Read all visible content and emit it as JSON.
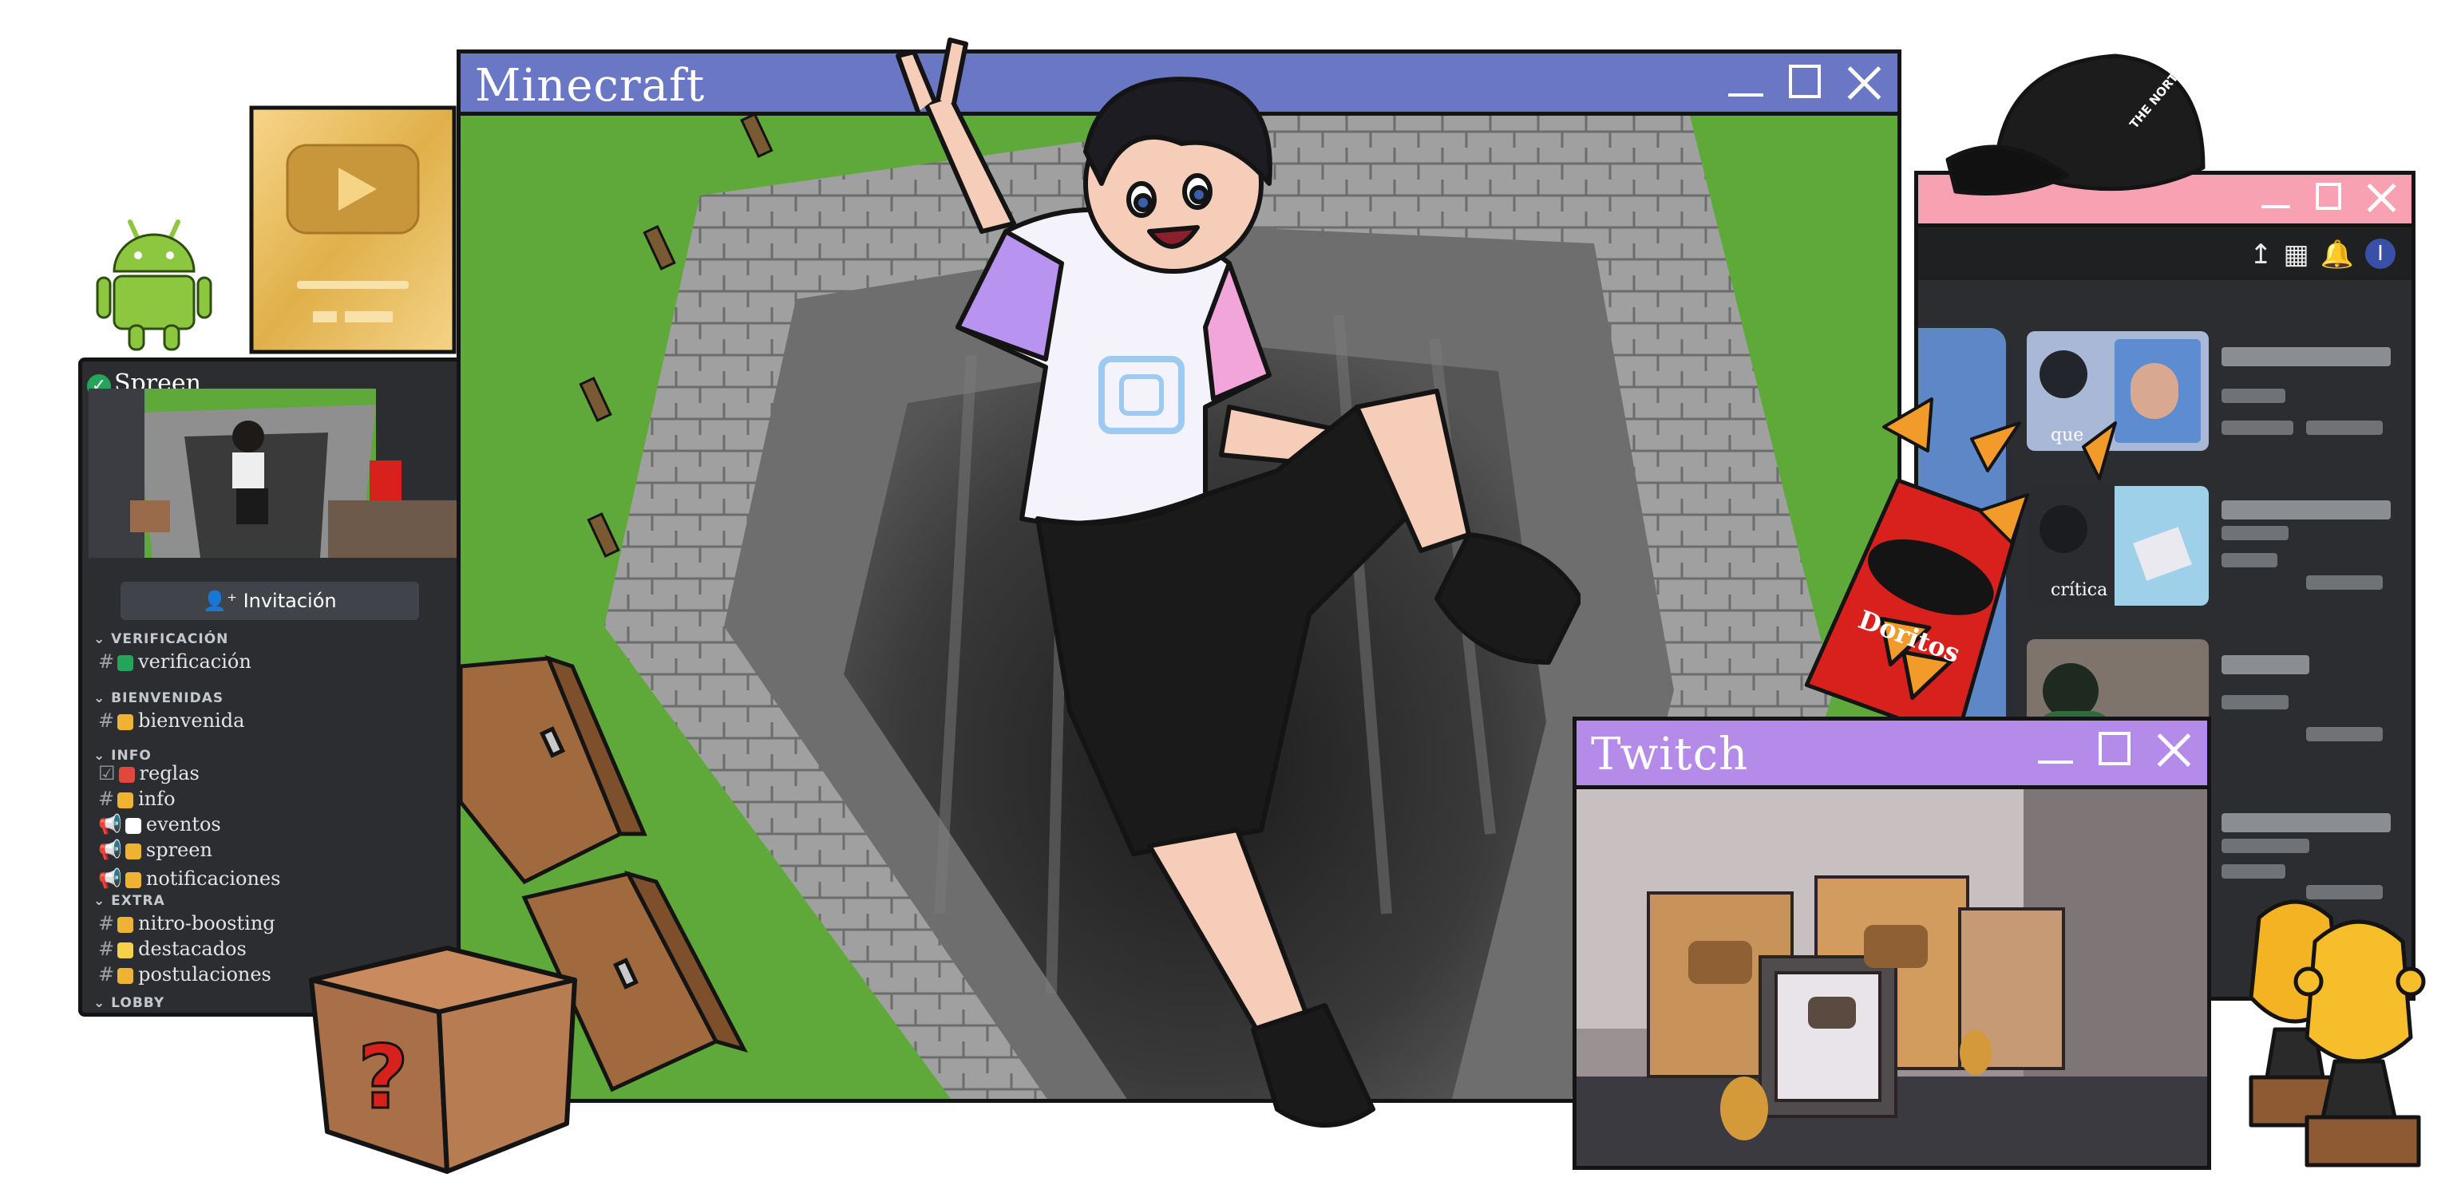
{
  "minecraft_window": {
    "title": "Minecraft"
  },
  "twitch_window": {
    "title": "Twitch"
  },
  "discord": {
    "server_name": "Spreen",
    "invite_label": "Invitación",
    "categories": [
      {
        "name": "VERIFICACIÓN",
        "channels": [
          "verificación"
        ]
      },
      {
        "name": "BIENVENIDAS",
        "channels": [
          "bienvenida"
        ]
      },
      {
        "name": "INFO",
        "channels": [
          "reglas",
          "info",
          "eventos",
          "spreen",
          "notificaciones"
        ]
      },
      {
        "name": "EXTRA",
        "channels": [
          "nitro-boosting",
          "destacados",
          "postulaciones"
        ]
      },
      {
        "name": "LOBBY",
        "channels": []
      }
    ]
  },
  "youtube_window": {
    "topbar_avatar_letter": "I",
    "video_captions": [
      "que",
      "crítica"
    ]
  },
  "cap_brand": "THE NORTH FACE",
  "chip_bag_brand": "Doritos",
  "colors": {
    "minecraft_title": "#6a77c4",
    "twitch_title": "#b58bea",
    "youtube_title": "#f7a1b3",
    "grass": "#5fa83a",
    "stone": "#9b9b9b",
    "android_green": "#8dc63f",
    "doritos_red": "#d8201c"
  }
}
